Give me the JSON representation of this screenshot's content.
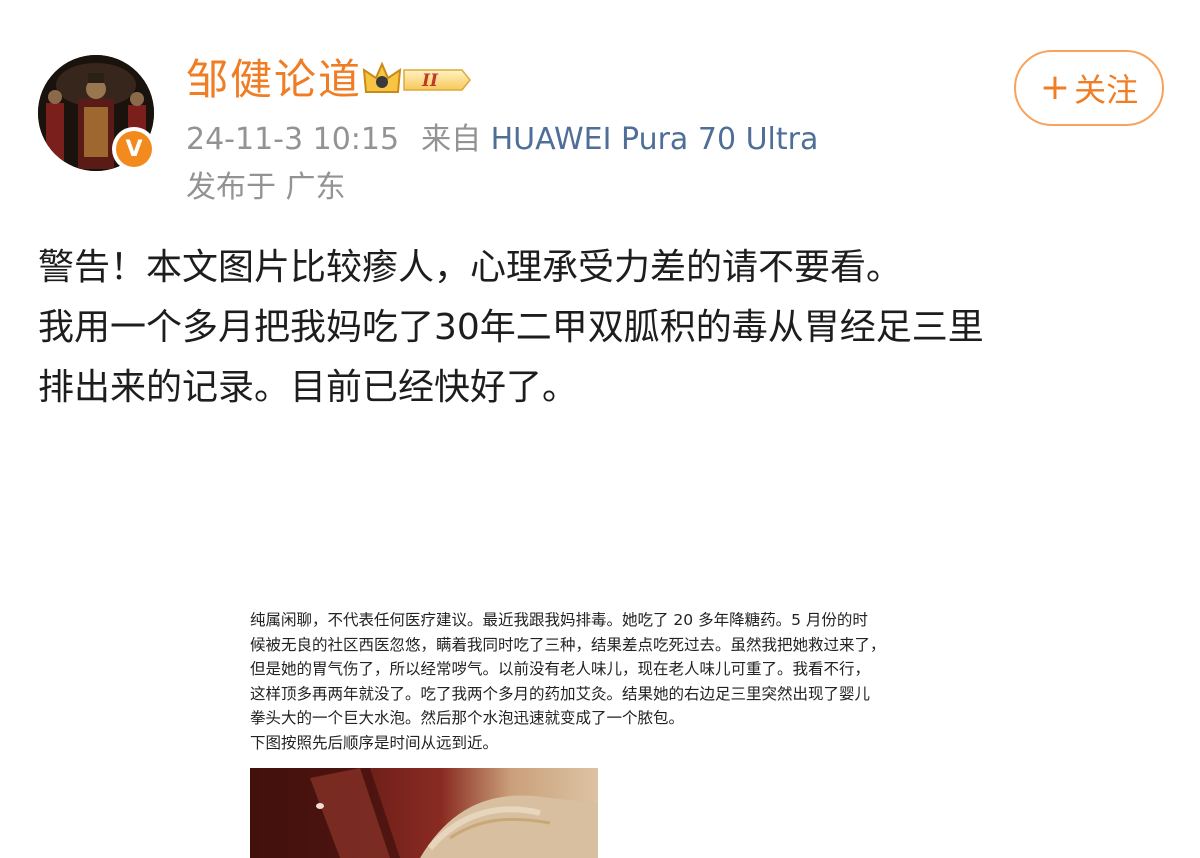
{
  "author": {
    "name": "邹健论道",
    "verified_mark": "V",
    "member_badge_icon": "crown-level-2-badge",
    "member_level": "II"
  },
  "meta": {
    "time": "24-11-3 10:15",
    "source_prefix": "来自",
    "device": "HUAWEI Pura 70 Ultra",
    "location": "发布于 广东"
  },
  "follow_button": {
    "plus": "+",
    "label": "关注"
  },
  "post": {
    "lines": [
      "警告！本文图片比较瘆人，心理承受力差的请不要看。",
      "我用一个多月把我妈吃了30年二甲双胍积的毒从胃经足三里",
      "排出来的记录。目前已经快好了。"
    ]
  },
  "attachment": {
    "lines": [
      "纯属闲聊，不代表任何医疗建议。最近我跟我妈排毒。她吃了 20 多年降糖药。5 月份的时",
      "候被无良的社区西医忽悠，瞒着我同时吃了三种，结果差点吃死过去。虽然我把她救过来了，",
      "但是她的胃气伤了，所以经常哕气。以前没有老人味儿，现在老人味儿可重了。我看不行，",
      "这样顶多再两年就没了。吃了我两个多月的药加艾灸。结果她的右边足三里突然出现了婴儿",
      "拳头大的一个巨大水泡。然后那个水泡迅速就变成了一个脓包。",
      "下图按照先后顺序是时间从远到近。"
    ]
  },
  "colors": {
    "username": "#f07d24",
    "meta_gray": "#939393",
    "device_link": "#4f6e98",
    "follow_border": "#f7a35c",
    "body_text": "#1d1d1d"
  }
}
